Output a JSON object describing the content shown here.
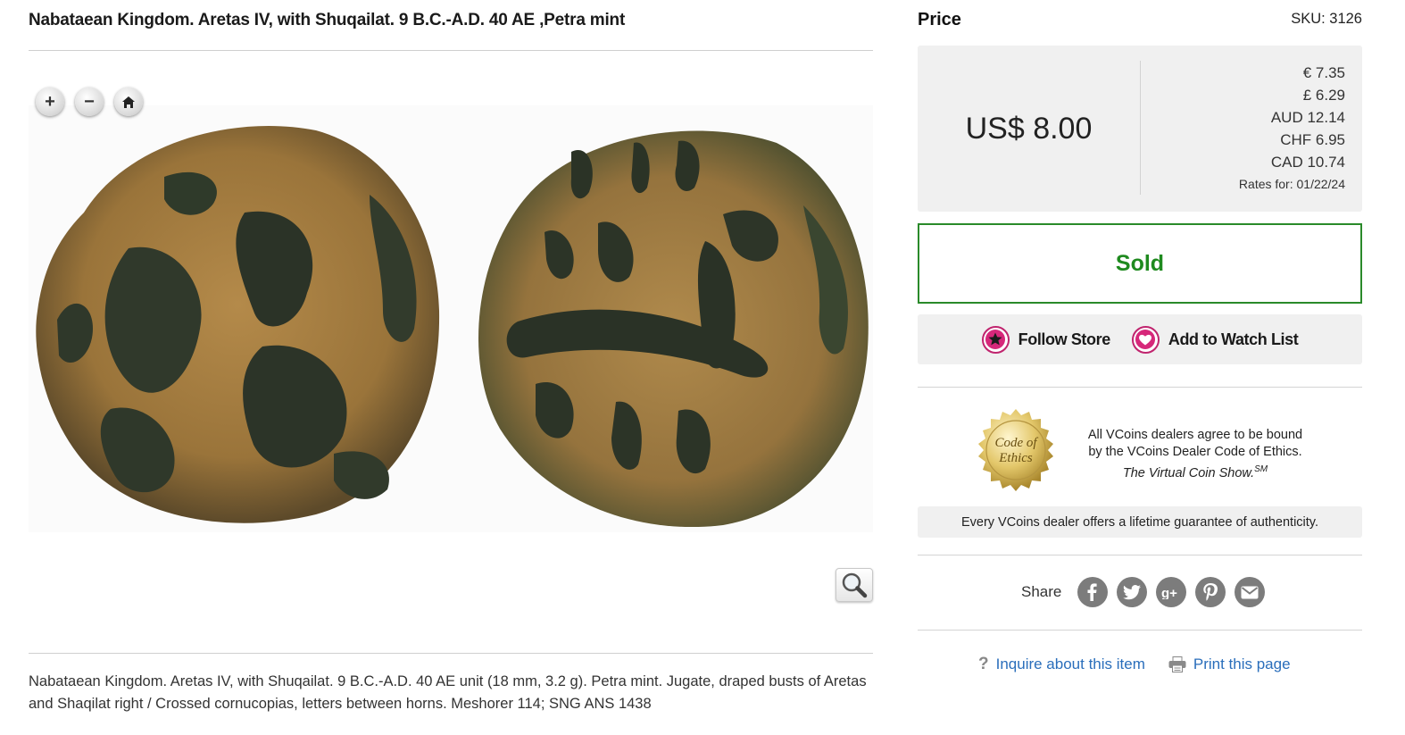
{
  "item": {
    "title": "Nabataean Kingdom. Aretas IV, with Shuqailat. 9 B.C.-A.D. 40 AE ,Petra mint",
    "description": "Nabataean Kingdom. Aretas IV, with Shuqailat. 9 B.C.-A.D. 40 AE unit (18 mm, 3.2 g). Petra mint. Jugate, draped busts of Aretas and Shaqilat right / Crossed cornucopias, letters between horns. Meshorer 114; SNG ANS 1438"
  },
  "viewer": {
    "zoom_in": "+",
    "zoom_out": "−",
    "home_icon": "home-icon",
    "magnifier_icon": "magnifier-icon"
  },
  "price": {
    "heading": "Price",
    "sku": "SKU: 3126",
    "main": "US$ 8.00",
    "rates": [
      "€ 7.35",
      "£ 6.29",
      "AUD 12.14",
      "CHF 6.95",
      "CAD 10.74"
    ],
    "rates_date": "Rates for: 01/22/24"
  },
  "status": {
    "label": "Sold",
    "color": "#1f8a1f"
  },
  "actions": {
    "follow_store": "Follow Store",
    "watch_list": "Add to Watch List"
  },
  "ethics": {
    "seal_line1": "Code of",
    "seal_line2": "Ethics",
    "line1": "All VCoins dealers agree to be bound",
    "line2": "by the VCoins Dealer Code of Ethics.",
    "line3": "The Virtual Coin Show.",
    "line3_sup": "SM",
    "guarantee": "Every VCoins dealer offers a lifetime guarantee of authenticity."
  },
  "share": {
    "label": "Share",
    "icons": [
      "facebook-icon",
      "twitter-icon",
      "google-plus-icon",
      "pinterest-icon",
      "email-icon"
    ]
  },
  "links": {
    "inquire": "Inquire about this item",
    "print": "Print this page",
    "link_color": "#2a6ebb"
  }
}
